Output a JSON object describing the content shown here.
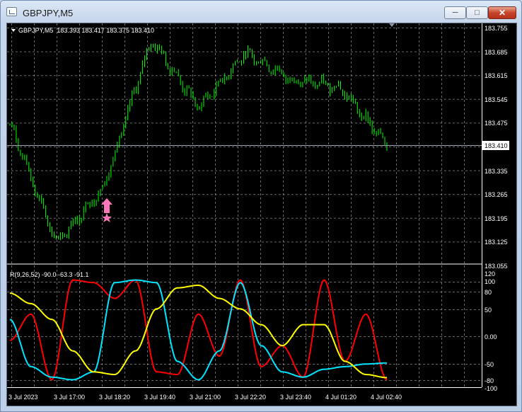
{
  "window": {
    "title": "GBPJPY,M5",
    "min_icon": "minimize-icon",
    "max_icon": "maximize-icon",
    "close_icon": "close-icon"
  },
  "main_chart": {
    "header": "GBPJPY,M5  183.393 183.417 183.375 183.410",
    "current_price_label": "183.410",
    "price_axis_labels": [
      "183.755",
      "183.685",
      "183.615",
      "183.545",
      "183.475",
      "183.410",
      "183.335",
      "183.265",
      "183.195",
      "183.125",
      "183.055"
    ]
  },
  "indicator": {
    "header": "R(9,26,52) -90.0 -63.3 -91.1",
    "axis_labels": [
      "120",
      "100",
      "80",
      "50",
      "0.00",
      "-50",
      "-80",
      "-100"
    ]
  },
  "time_axis_labels": [
    "3 Jul 2023",
    "3 Jul 17:00",
    "3 Jul 18:20",
    "3 Jul 19:40",
    "3 Jul 21:00",
    "3 Jul 22:20",
    "3 Jul 23:40",
    "4 Jul 01:20",
    "4 Jul 02:40"
  ],
  "colors": {
    "background": "#000000",
    "grid": "#c0c0c0",
    "candles": "#00ff00",
    "signal_arrow": "#ff77b8",
    "line_fast": "#ff0000",
    "line_mid": "#00e5ff",
    "line_slow": "#ffff00"
  },
  "chart_data": {
    "type": "line",
    "series": [
      {
        "name": "GBPJPY,M5",
        "kind": "close",
        "x": [
          "3 Jul 2023",
          "3 Jul 17:00",
          "3 Jul 18:20",
          "3 Jul 19:40",
          "3 Jul 21:00",
          "3 Jul 22:20",
          "3 Jul 23:40",
          "4 Jul 01:20",
          "4 Jul 02:40"
        ],
        "values": [
          183.47,
          183.12,
          183.29,
          183.72,
          183.52,
          183.68,
          183.6,
          183.58,
          183.41
        ]
      },
      {
        "name": "R(9)",
        "values": [
          -20,
          30,
          -95,
          95,
          90,
          60,
          95,
          -80,
          -85,
          30,
          -50,
          95,
          -70,
          -30,
          -90,
          95,
          -60,
          30,
          -95
        ]
      },
      {
        "name": "R(26)",
        "values": [
          20,
          -70,
          -90,
          -95,
          -80,
          90,
          95,
          90,
          -60,
          -95,
          -40,
          90,
          -30,
          -80,
          -90,
          -75,
          -70,
          -65,
          -63
        ]
      },
      {
        "name": "R(52)",
        "values": [
          70,
          50,
          20,
          -40,
          -80,
          -85,
          -40,
          40,
          80,
          85,
          60,
          40,
          10,
          -30,
          10,
          10,
          -60,
          -85,
          -91
        ]
      }
    ],
    "price_range": [
      183.055,
      183.755
    ],
    "indicator_range": [
      -120,
      120
    ]
  }
}
